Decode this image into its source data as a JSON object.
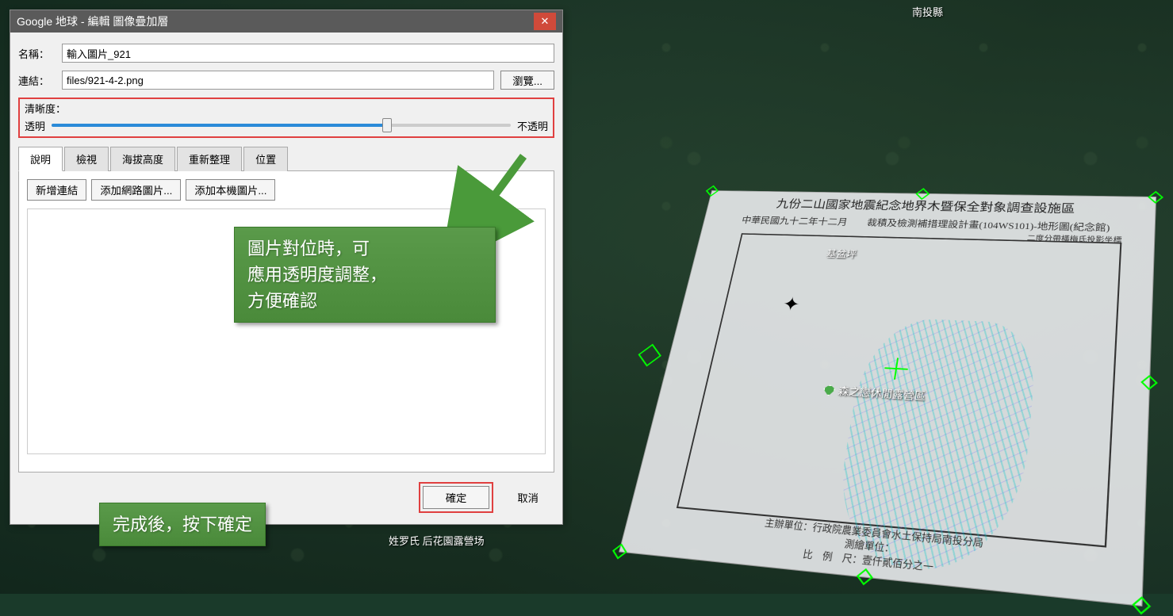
{
  "dialog": {
    "title": "Google 地球 - 編輯 圖像疊加層",
    "name_label": "名稱：",
    "name_value": "輸入圖片_921",
    "link_label": "連結：",
    "link_value": "files/921-4-2.png",
    "browse": "瀏覽...",
    "clarity_label": "清晰度：",
    "transparent": "透明",
    "opaque": "不透明",
    "tabs": {
      "desc": "說明",
      "view": "檢視",
      "altitude": "海拔高度",
      "refresh": "重新整理",
      "location": "位置"
    },
    "buttons": {
      "add_link": "新增連結",
      "add_web_img": "添加網路圖片...",
      "add_local_img": "添加本機圖片..."
    },
    "ok": "確定",
    "cancel": "取消"
  },
  "callout1": {
    "l1": "圖片對位時，可",
    "l2": "應用透明度調整，",
    "l3": "方便確認"
  },
  "callout2": "完成後，按下確定",
  "overlay": {
    "title": "九份二山國家地震紀念地界木暨保全對象調查設施區",
    "subtitle": "中華民國九十二年十二月  裁積及檢測補措理設計畫(104WS101)-地形圖(紀念館)",
    "right_note": "二度分帶橫梅氏投影坐標",
    "footer1": "主辦單位：行政院農業委員會水土保持局南投分局",
    "footer2": "測繪單位：",
    "footer3": "比 例 尺：壹仟貳佰分之一",
    "place_basin": "基盆坪",
    "place_camp": "森之戀休閒露營區"
  },
  "bg_labels": {
    "top_right": "南投縣",
    "bottom": "姓罗氏 后花園露營场"
  }
}
